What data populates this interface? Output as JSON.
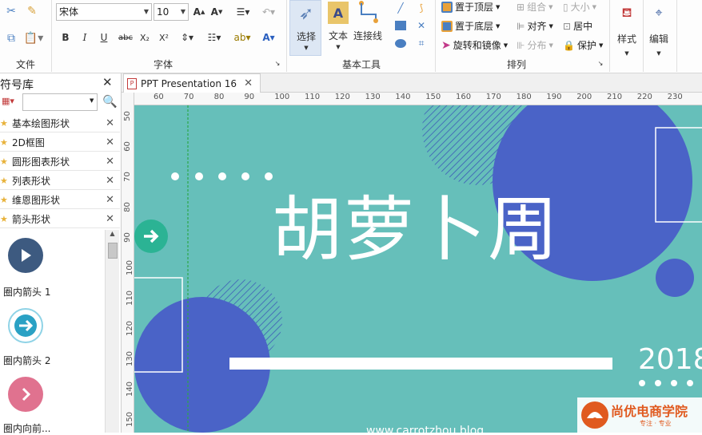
{
  "colors": {
    "teal": "#66bfba",
    "circle_blue": "#4a63c7",
    "arrow_green": "#2bb394",
    "accent_red": "#e05a1f"
  },
  "ribbon": {
    "font_name": "宋体",
    "font_size": "10",
    "groups": {
      "file": "文件",
      "font": "字体",
      "basic_tools": "基本工具",
      "arrange": "排列"
    },
    "tools": {
      "select": "选择",
      "text": "文本",
      "connector": "连接线"
    },
    "arrange": {
      "bring_front": "置于顶层",
      "send_back": "置于底层",
      "rotate_mirror": "旋转和镜像",
      "group": "组合",
      "align": "对齐",
      "distribute": "分布",
      "size": "大小",
      "center": "居中",
      "protect": "保护"
    },
    "style": "样式",
    "edit": "编辑",
    "font_buttons": [
      "B",
      "I",
      "U",
      "abc",
      "X₂",
      "X²"
    ]
  },
  "symbol_library": {
    "title": "符号库",
    "search_placeholder": "",
    "libraries": [
      {
        "label": "基本绘图形状"
      },
      {
        "label": "2D框图"
      },
      {
        "label": "圆形图表形状"
      },
      {
        "label": "列表形状"
      },
      {
        "label": "维恩图形状"
      },
      {
        "label": "箭头形状"
      }
    ],
    "shapes": [
      {
        "label": "圈内箭头 1",
        "icon": "play-circle-icon"
      },
      {
        "label": "圈内箭头 2",
        "icon": "arrow-circle-icon"
      },
      {
        "label": "圈内向前...",
        "icon": "chevron-circle-icon"
      }
    ]
  },
  "document_tab": {
    "title": "PPT Presentation 16"
  },
  "ruler": {
    "horizontal": [
      "60",
      "70",
      "80",
      "90",
      "100",
      "110",
      "120",
      "130",
      "140",
      "150",
      "160",
      "170",
      "180",
      "190",
      "200",
      "210",
      "220",
      "230"
    ],
    "vertical": [
      "50",
      "60",
      "70",
      "80",
      "90",
      "100",
      "110",
      "120",
      "130",
      "140",
      "150"
    ]
  },
  "slide": {
    "title": "胡萝卜周",
    "year": "2018",
    "url": "www.carrotzhou.blog",
    "watermark_main": "尚优电商学院",
    "watermark_sub": "专注 · 专业"
  }
}
